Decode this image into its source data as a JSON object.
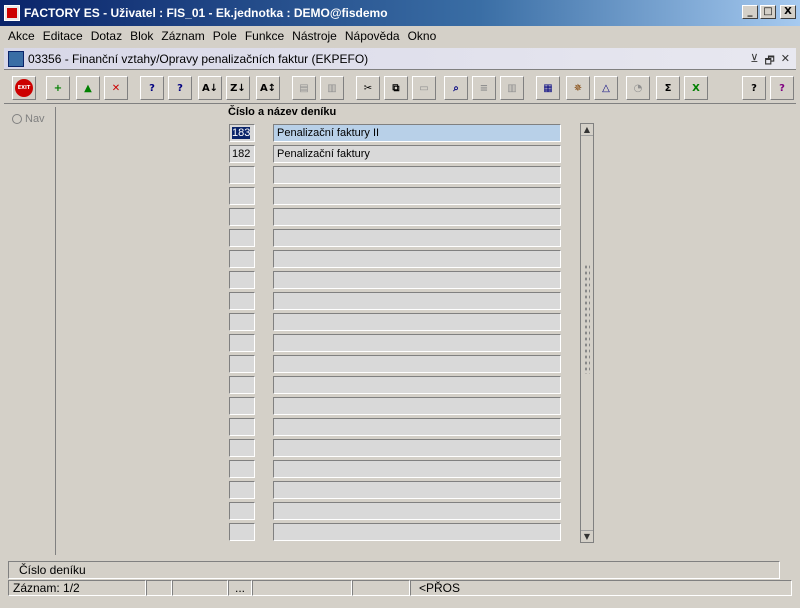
{
  "window": {
    "title": "FACTORY ES - Uživatel : FIS_01 - Ek.jednotka : DEMO@fisdemo",
    "minimize": "_",
    "maximize": "□",
    "close": "X"
  },
  "menu": [
    "Akce",
    "Editace",
    "Dotaz",
    "Blok",
    "Záznam",
    "Pole",
    "Funkce",
    "Nástroje",
    "Nápověda",
    "Okno"
  ],
  "form": {
    "title": "03356 - Finanční vztahy/Opravy penalizačních faktur (EKPEFO)",
    "controls": [
      "⊻",
      "🗗",
      "✕"
    ]
  },
  "toolbar": [
    {
      "icon": "exit-icon",
      "glyph": "EXIT",
      "color": "#cc0000"
    },
    {
      "icon": "insert-record-icon",
      "glyph": "+",
      "color": "#008000"
    },
    {
      "icon": "save-icon",
      "glyph": "▲",
      "color": "#008000"
    },
    {
      "icon": "delete-record-icon",
      "glyph": "✕",
      "color": "#cc0000"
    },
    {
      "icon": "query-enter-icon",
      "glyph": "?",
      "color": "#000080"
    },
    {
      "icon": "query-execute-icon",
      "glyph": "?",
      "color": "#000080"
    },
    {
      "icon": "sort-asc-icon",
      "glyph": "A↓",
      "color": "#000000"
    },
    {
      "icon": "sort-desc-icon",
      "glyph": "Z↓",
      "color": "#000000"
    },
    {
      "icon": "sort-multi-icon",
      "glyph": "A↕",
      "color": "#000000"
    },
    {
      "icon": "print-icon",
      "glyph": "▤",
      "color": "#909090"
    },
    {
      "icon": "print-preview-icon",
      "glyph": "▥",
      "color": "#909090"
    },
    {
      "icon": "cut-icon",
      "glyph": "✂",
      "color": "#000000"
    },
    {
      "icon": "copy-icon",
      "glyph": "⧉",
      "color": "#000000"
    },
    {
      "icon": "paste-icon",
      "glyph": "▭",
      "color": "#909090"
    },
    {
      "icon": "search-icon",
      "glyph": "⌕",
      "color": "#000080"
    },
    {
      "icon": "lines-icon",
      "glyph": "≡",
      "color": "#909090"
    },
    {
      "icon": "columns-icon",
      "glyph": "▥",
      "color": "#909090"
    },
    {
      "icon": "calculator-icon",
      "glyph": "▦",
      "color": "#000080"
    },
    {
      "icon": "wheel-icon",
      "glyph": "✵",
      "color": "#804000"
    },
    {
      "icon": "triangle-icon",
      "glyph": "△",
      "color": "#000080"
    },
    {
      "icon": "chart-icon",
      "glyph": "◔",
      "color": "#909090"
    },
    {
      "icon": "sum-icon",
      "glyph": "Σ",
      "color": "#000000"
    },
    {
      "icon": "excel-icon",
      "glyph": "X",
      "color": "#008000"
    },
    {
      "icon": "help-icon",
      "glyph": "?",
      "color": "#000000"
    },
    {
      "icon": "context-help-icon",
      "glyph": "?",
      "color": "#800080"
    }
  ],
  "nav": {
    "label": "Nav"
  },
  "block": {
    "column_header": "Číslo a název deníku",
    "rows": [
      {
        "num": "183",
        "name": "Penalizační faktury II"
      },
      {
        "num": "182",
        "name": "Penalizační faktury"
      },
      {
        "num": "",
        "name": ""
      },
      {
        "num": "",
        "name": ""
      },
      {
        "num": "",
        "name": ""
      },
      {
        "num": "",
        "name": ""
      },
      {
        "num": "",
        "name": ""
      },
      {
        "num": "",
        "name": ""
      },
      {
        "num": "",
        "name": ""
      },
      {
        "num": "",
        "name": ""
      },
      {
        "num": "",
        "name": ""
      },
      {
        "num": "",
        "name": ""
      },
      {
        "num": "",
        "name": ""
      },
      {
        "num": "",
        "name": ""
      },
      {
        "num": "",
        "name": ""
      },
      {
        "num": "",
        "name": ""
      },
      {
        "num": "",
        "name": ""
      },
      {
        "num": "",
        "name": ""
      },
      {
        "num": "",
        "name": ""
      },
      {
        "num": "",
        "name": ""
      }
    ]
  },
  "hint": "Číslo deníku",
  "status": {
    "record": "Záznam: 1/2",
    "seg2": "",
    "seg3": "",
    "seg4": "...",
    "seg5": "",
    "seg6": "",
    "mode": "<PŘOS"
  }
}
